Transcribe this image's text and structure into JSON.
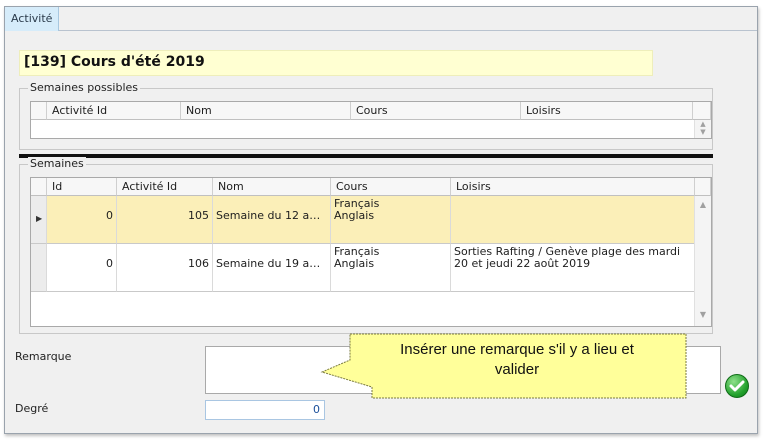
{
  "window": {
    "tab_label": "Activité"
  },
  "title": "[139] Cours d'été 2019",
  "possible_weeks": {
    "group_label": "Semaines possibles",
    "columns": [
      "Activité Id",
      "Nom",
      "Cours",
      "Loisirs"
    ]
  },
  "weeks": {
    "group_label": "Semaines",
    "columns": [
      "Id",
      "Activité Id",
      "Nom",
      "Cours",
      "Loisirs"
    ],
    "rows": [
      {
        "id": "0",
        "activity_id": "105",
        "name": "Semaine du 12 au 1...",
        "course_1": "Français",
        "course_2": "Anglais",
        "leisure": "",
        "selected": true
      },
      {
        "id": "0",
        "activity_id": "106",
        "name": "Semaine du 19 au 2...",
        "course_1": "Français",
        "course_2": "Anglais",
        "leisure": "Sorties Rafting / Genève plage des mardi 20 et jeudi 22 août 2019",
        "selected": false
      }
    ]
  },
  "remark": {
    "label": "Remarque",
    "value": ""
  },
  "degree": {
    "label": "Degré",
    "value": "0"
  },
  "tooltip": {
    "line1": "Insérer une remarque s'il y a lieu et",
    "line2": "valider"
  },
  "icons": {
    "ok": "check-circle-icon",
    "row_pointer": "row-indicator-icon"
  },
  "colors": {
    "title_bg": "#ffffd2",
    "tooltip_bg": "#ffff9a",
    "selected_row_bg": "#fbefb8",
    "ok_green": "#21a02b"
  }
}
